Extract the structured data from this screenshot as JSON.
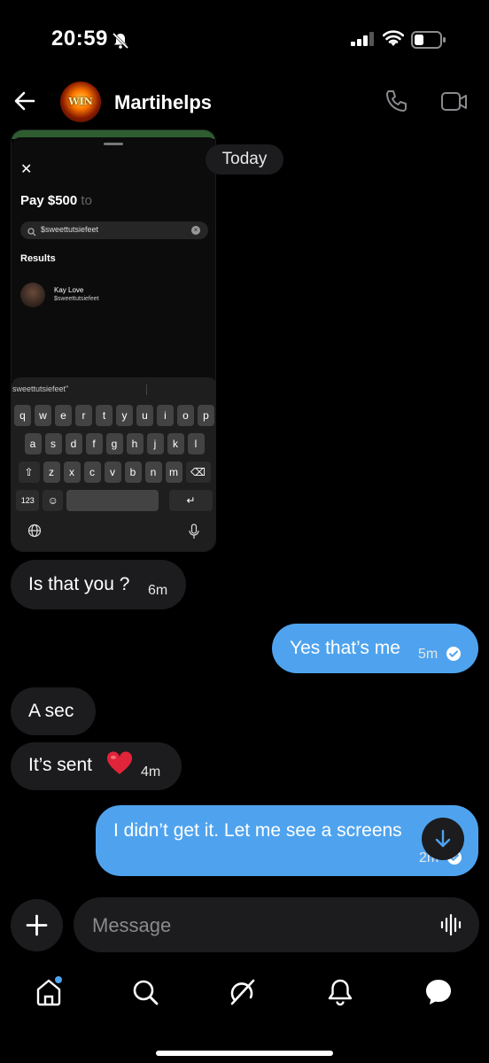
{
  "status": {
    "time": "20:59"
  },
  "header": {
    "title": "Martihelps",
    "avatar_text": "WIN"
  },
  "date_divider": "Today",
  "shared_screenshot": {
    "pay_amount": "Pay $500",
    "pay_to": "to",
    "search_value": "$sweettutsiefeet",
    "results_label": "Results",
    "result_name": "Kay Love",
    "result_handle": "$sweettutsiefeet",
    "keyboard_suggestion": "sweettutsiefeet\"",
    "keys_row1": [
      "q",
      "w",
      "e",
      "r",
      "t",
      "y",
      "u",
      "i",
      "o",
      "p"
    ],
    "keys_row2": [
      "a",
      "s",
      "d",
      "f",
      "g",
      "h",
      "j",
      "k",
      "l"
    ],
    "keys_row3": [
      "z",
      "x",
      "c",
      "v",
      "b",
      "n",
      "m"
    ],
    "key_123": "123"
  },
  "messages": [
    {
      "direction": "incoming",
      "text": "Is that you ?",
      "time": "6m"
    },
    {
      "direction": "outgoing",
      "text": "Yes that’s me",
      "time": "5m",
      "read": true
    },
    {
      "direction": "incoming",
      "text": "A sec"
    },
    {
      "direction": "incoming",
      "text": "It’s sent",
      "emoji": "❤️",
      "time": "4m"
    },
    {
      "direction": "outgoing",
      "text": "I didn’t get it. Let me see a screens",
      "time": "2m",
      "read": true
    }
  ],
  "composer": {
    "placeholder": "Message"
  },
  "colors": {
    "accent": "#4fa3ee",
    "incoming_bubble": "#1c1c1e",
    "background": "#000000"
  },
  "nav": [
    "home-icon",
    "search-icon",
    "grok-icon",
    "notifications-icon",
    "messages-icon"
  ]
}
